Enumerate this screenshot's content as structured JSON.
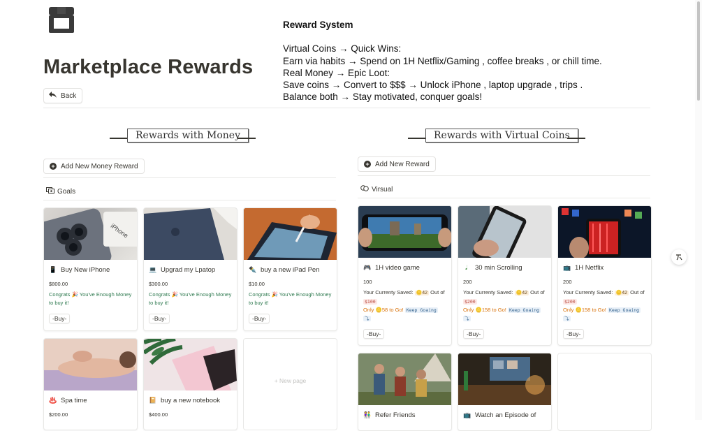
{
  "page": {
    "title": "Marketplace Rewards",
    "icon": "store-icon",
    "back_label": "Back"
  },
  "reward_system": {
    "title": "Reward System",
    "lines": [
      "Virtual Coins → Quick Wins:",
      "Earn via habits → Spend on 1H Netflix/Gaming , coffee breaks , or chill time.",
      "Real Money → Epic Loot:",
      "Save coins → Convert to $$$ → Unlock iPhone , laptop upgrade , trips .",
      "Balance both → Stay motivated, conquer goals!"
    ]
  },
  "money_section": {
    "heading": "Rewards with Money",
    "add_label": "Add New Money Reward",
    "view_label": "Goals",
    "cards": [
      {
        "title": "Buy New iPhone",
        "icon": "phone-icon",
        "price": "$800.00",
        "congrats": "Congrats 🎉 You've Enough Money to buy it!",
        "buy": "-Buy-"
      },
      {
        "title": "Upgrad my Lpatop",
        "icon": "laptop-icon",
        "price": "$300.00",
        "congrats": "Congrats 🎉 You've Enough Money to buy it!",
        "buy": "-Buy-"
      },
      {
        "title": "buy a new iPad Pen",
        "icon": "pen-icon",
        "price": "$10.00",
        "congrats": "Congrats 🎉 You've Enough Money to buy it!",
        "buy": "-Buy-"
      },
      {
        "title": "Spa time",
        "icon": "spa-icon",
        "price": "$200.00"
      },
      {
        "title": "buy a new notebook",
        "icon": "notebook-icon",
        "price": "$400.00"
      }
    ],
    "new_page_label": "+ New page"
  },
  "coins_section": {
    "heading": "Rewards with Virtual Coins",
    "add_label": "Add New Reward",
    "view_label": "Virsual",
    "cards": [
      {
        "title": "1H video game",
        "icon": "gamepad-icon",
        "cost": "100",
        "saved_label": "Your Currenty Saved:",
        "saved_value": "🪙42",
        "out_of": "Out of",
        "target": "$100",
        "only": "Only 🪙58 to Go!",
        "keep": "Keep Goaing",
        "keep_tail": "⤵",
        "buy": "-Buy-"
      },
      {
        "title": "30 min Scrolling",
        "icon": "phone-scroll-icon",
        "cost": "200",
        "saved_label": "Your Currenty Saved:",
        "saved_value": "🪙42",
        "out_of": "Out of",
        "target": "$200",
        "only": "Only 🪙158 to Go!",
        "keep": "Keep Goaing",
        "keep_tail": "⤵",
        "buy": "-Buy-"
      },
      {
        "title": "1H Netflix",
        "icon": "tv-icon",
        "cost": "200",
        "saved_label": "Your Currenty Saved:",
        "saved_value": "🪙42",
        "out_of": "Out of",
        "target": "$200",
        "only": "Only 🪙158 to Go!",
        "keep": "Keep Goaing",
        "keep_tail": "⤵",
        "buy": "-Buy-"
      },
      {
        "title": "Refer Friends",
        "icon": "people-icon"
      },
      {
        "title": "Watch an Episode of",
        "icon": "tv-icon"
      }
    ]
  },
  "colors": {
    "text": "#37352f",
    "congrats_green": "#2f7a50",
    "warning_orange": "#d9730d",
    "border": "#e8e8e6"
  }
}
